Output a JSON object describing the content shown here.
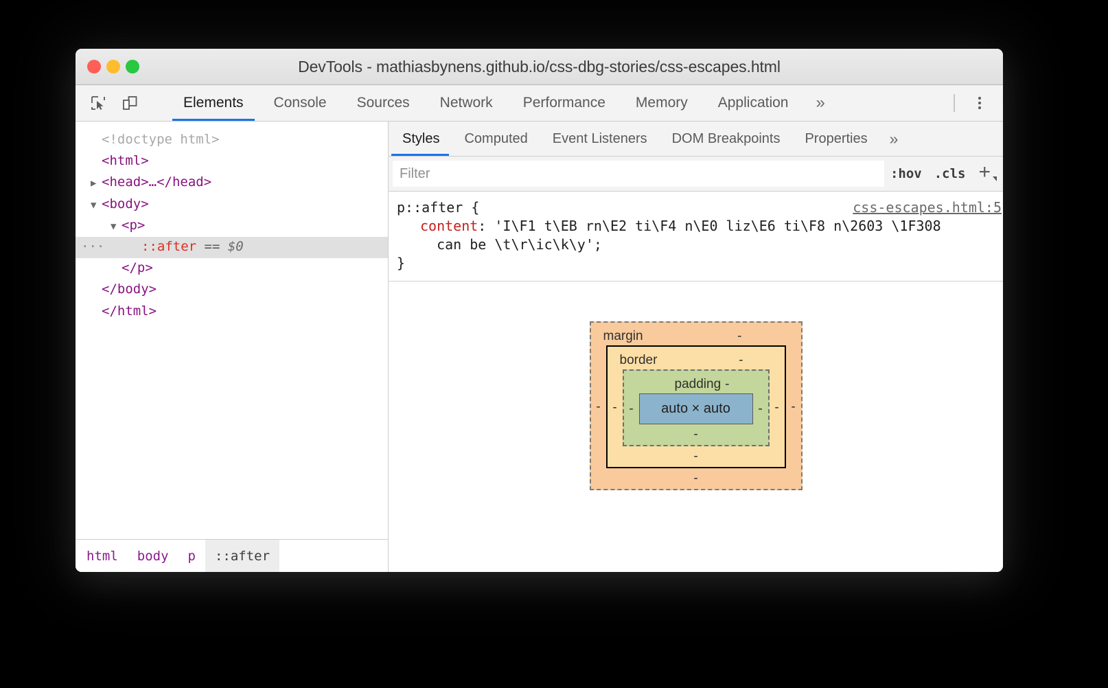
{
  "window": {
    "title": "DevTools - mathiasbynens.github.io/css-dbg-stories/css-escapes.html",
    "traffic_lights": [
      "close",
      "minimize",
      "maximize"
    ]
  },
  "main_toolbar": {
    "inspect_icon": "inspect-element-icon",
    "device_icon": "device-toolbar-icon",
    "menu_icon": "kebab-menu-icon",
    "tabs": [
      {
        "label": "Elements",
        "active": true
      },
      {
        "label": "Console",
        "active": false
      },
      {
        "label": "Sources",
        "active": false
      },
      {
        "label": "Network",
        "active": false
      },
      {
        "label": "Performance",
        "active": false
      },
      {
        "label": "Memory",
        "active": false
      },
      {
        "label": "Application",
        "active": false
      }
    ],
    "more_tabs": "»"
  },
  "dom_tree": {
    "lines": [
      {
        "indent": 0,
        "arrow": "",
        "text": "<!doctype html>",
        "type": "doctype",
        "selected": false
      },
      {
        "indent": 0,
        "arrow": "",
        "text": "<html>",
        "type": "tag",
        "selected": false
      },
      {
        "indent": 0,
        "arrow": "▶",
        "text": "<head>…</head>",
        "type": "tag",
        "selected": false
      },
      {
        "indent": 0,
        "arrow": "▼",
        "text": "<body>",
        "type": "tag",
        "selected": false
      },
      {
        "indent": 1,
        "arrow": "▼",
        "text": "<p>",
        "type": "tag",
        "selected": false
      },
      {
        "indent": 2,
        "arrow": "",
        "text": "::after",
        "suffix": " == ",
        "dollar": "$0",
        "type": "pseudo",
        "selected": true,
        "ellipsis": "…"
      },
      {
        "indent": 1,
        "arrow": "",
        "text": "</p>",
        "type": "tag",
        "selected": false
      },
      {
        "indent": 0,
        "arrow": "",
        "text": "</body>",
        "type": "tag",
        "selected": false
      },
      {
        "indent": 0,
        "arrow": "",
        "text": "</html>",
        "type": "tag",
        "selected": false
      }
    ]
  },
  "breadcrumb": {
    "items": [
      {
        "label": "html",
        "active": false
      },
      {
        "label": "body",
        "active": false
      },
      {
        "label": "p",
        "active": false
      },
      {
        "label": "::after",
        "active": true
      }
    ]
  },
  "styles_panel": {
    "tabs": [
      {
        "label": "Styles",
        "active": true
      },
      {
        "label": "Computed",
        "active": false
      },
      {
        "label": "Event Listeners",
        "active": false
      },
      {
        "label": "DOM Breakpoints",
        "active": false
      },
      {
        "label": "Properties",
        "active": false
      }
    ],
    "more_tabs": "»",
    "filter": {
      "value": "",
      "placeholder": "Filter"
    },
    "toggles": {
      "hov": ":hov",
      "cls": ".cls",
      "new_rule": "+"
    },
    "rule": {
      "selector": "p::after {",
      "origin": "css-escapes.html:5",
      "property": "content",
      "value_line1": "'I\\F1 t\\EB rn\\E2 ti\\F4 n\\E0 liz\\E6 ti\\F8 n\\2603 \\1F308",
      "value_line2": "can be \\t\\r\\ic\\k\\y';",
      "close": "}"
    }
  },
  "box_model": {
    "margin_label": "margin",
    "margin_top": "-",
    "margin_right": "-",
    "margin_bottom": "-",
    "margin_left": "-",
    "border_label": "border",
    "border_top": "-",
    "border_right": "-",
    "border_bottom": "-",
    "border_left": "-",
    "padding_label": "padding",
    "padding_top": "-",
    "padding_right": "-",
    "padding_bottom": "-",
    "padding_left": "-",
    "content_size": "auto × auto",
    "colors": {
      "margin": "#f9cb9c",
      "border": "#fcdfa6",
      "padding": "#c3d69b",
      "content": "#8cb3cc"
    }
  },
  "colors": {
    "accent": "#1a73e8",
    "tag": "#881280",
    "pseudo": "#d93025",
    "property": "#c5221f"
  }
}
